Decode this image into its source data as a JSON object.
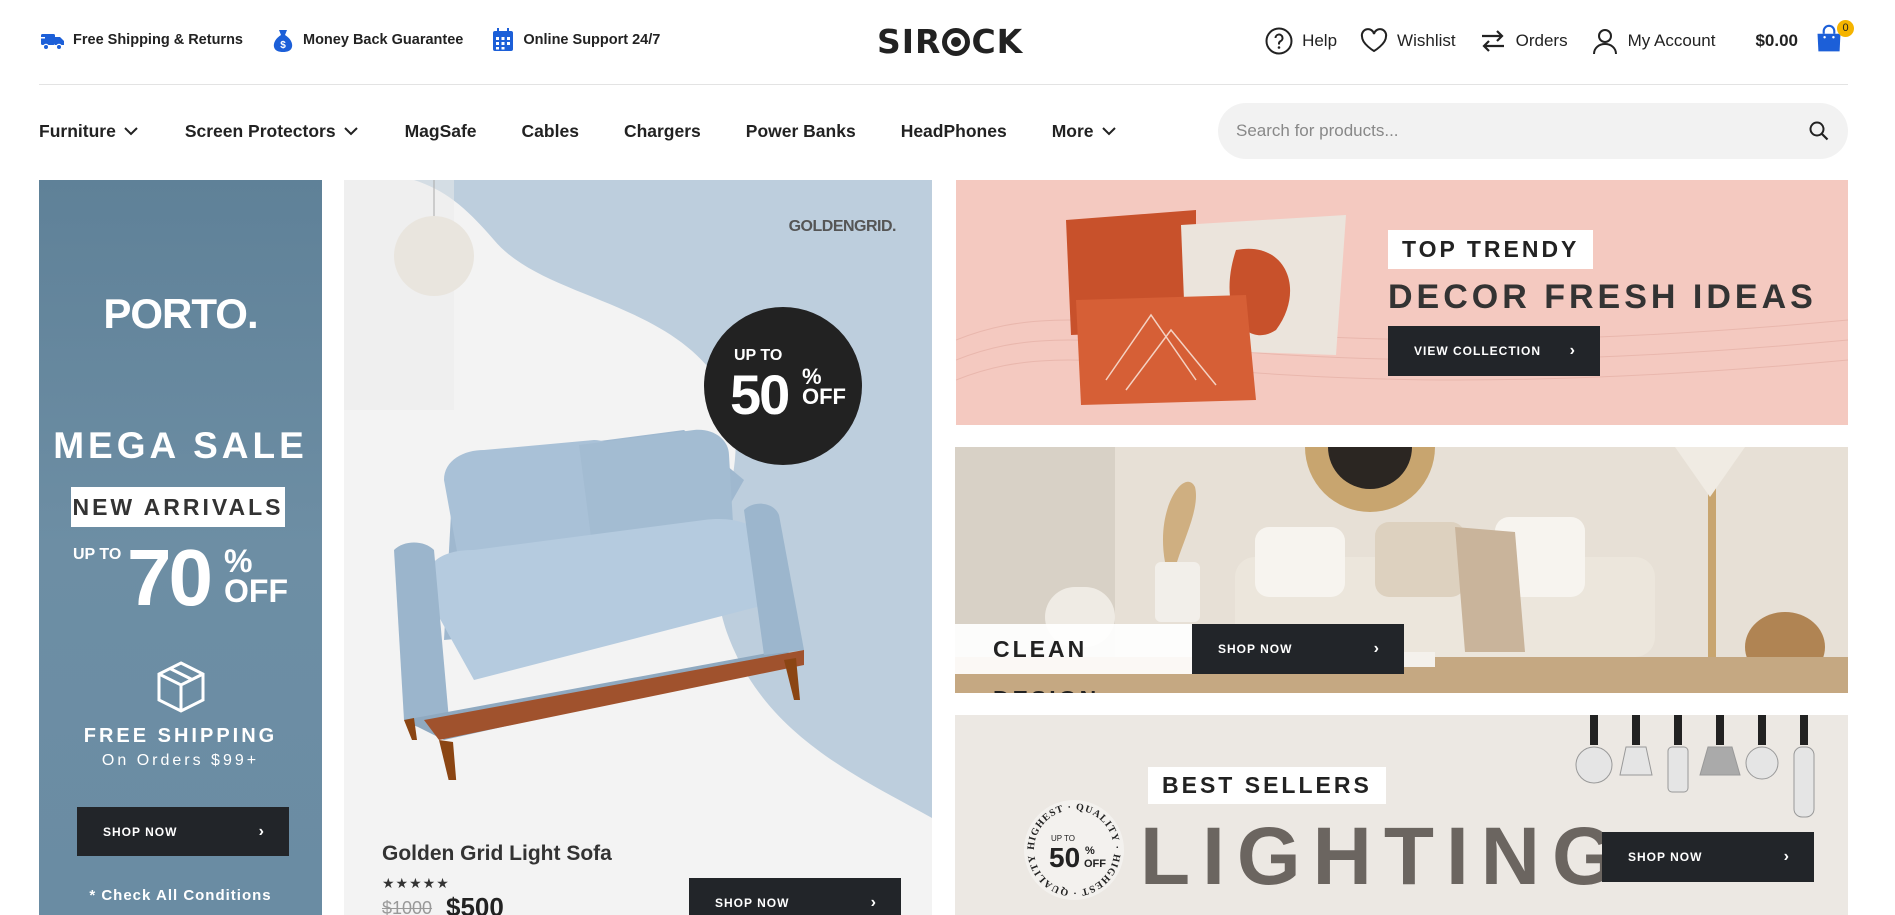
{
  "header": {
    "promos": [
      {
        "icon": "truck-icon",
        "label": "Free Shipping & Returns"
      },
      {
        "icon": "money-bag-icon",
        "label": "Money Back Guarantee"
      },
      {
        "icon": "calendar-icon",
        "label": "Online Support 24/7"
      }
    ],
    "logo": {
      "before": "SIR",
      "after": "CK"
    },
    "account": {
      "help": "Help",
      "wishlist": "Wishlist",
      "orders": "Orders",
      "my_account": "My Account",
      "cart_total": "$0.00",
      "cart_count": "0"
    }
  },
  "nav": {
    "items": [
      {
        "label": "Furniture",
        "dropdown": true
      },
      {
        "label": "Screen Protectors",
        "dropdown": true
      },
      {
        "label": "MagSafe",
        "dropdown": false
      },
      {
        "label": "Cables",
        "dropdown": false
      },
      {
        "label": "Chargers",
        "dropdown": false
      },
      {
        "label": "Power Banks",
        "dropdown": false
      },
      {
        "label": "HeadPhones",
        "dropdown": false
      },
      {
        "label": "More",
        "dropdown": true
      }
    ],
    "search_placeholder": "Search for products..."
  },
  "banner_left": {
    "logo": "PORTO.",
    "mega": "MEGA SALE",
    "new_arrivals": "NEW ARRIVALS",
    "up_to": "UP TO",
    "discount": "70",
    "pct": "%",
    "off": "OFF",
    "free_shipping": "FREE SHIPPING",
    "on_orders": "On Orders $99+",
    "button": "SHOP NOW",
    "conditions": "* Check All Conditions"
  },
  "banner_sofa": {
    "brand": "GOLDENGRID.",
    "up_to": "UP TO",
    "discount": "50",
    "pct": "%",
    "off": "OFF",
    "title": "Golden Grid Light Sofa",
    "stars": "★★★★★",
    "old_price": "$1000",
    "new_price": "$500",
    "button": "SHOP NOW"
  },
  "banner_decor": {
    "tag": "TOP TRENDY",
    "headline": "DECOR FRESH IDEAS",
    "button": "VIEW COLLECTION"
  },
  "banner_clean": {
    "headline": "CLEAN DESIGN",
    "button": "SHOP NOW"
  },
  "banner_lighting": {
    "tag": "BEST SELLERS",
    "headline": "LIGHTING",
    "seal_text": "HIGHEST · QUALITY · HIGHEST · QUALITY ·",
    "seal_up_to": "UP TO",
    "seal_discount": "50",
    "seal_pct": "%",
    "seal_off": "OFF",
    "button": "SHOP NOW"
  },
  "colors": {
    "accent_blue": "#1c5fd8",
    "dark_button": "#222529",
    "cart_badge": "#f5b400"
  }
}
